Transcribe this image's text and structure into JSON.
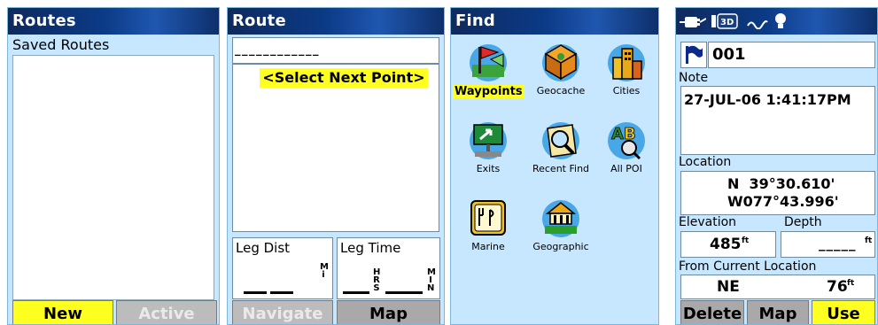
{
  "routes": {
    "title": "Routes",
    "saved_label": "Saved Routes",
    "new_button": "New",
    "active_button": "Active"
  },
  "route": {
    "title": "Route",
    "name_value": "____________",
    "select_next": "<Select Next Point>",
    "leg_dist_label": "Leg Dist",
    "leg_dist_unit": "Mi",
    "leg_time_label": "Leg Time",
    "leg_time_hrs": "HRS",
    "leg_time_min": "MIN",
    "navigate_button": "Navigate",
    "map_button": "Map"
  },
  "find": {
    "title": "Find",
    "items": [
      {
        "label": "Waypoints",
        "icon": "waypoints-icon",
        "selected": true
      },
      {
        "label": "Geocache",
        "icon": "geocache-icon"
      },
      {
        "label": "Cities",
        "icon": "cities-icon"
      },
      {
        "label": "Exits",
        "icon": "exits-icon"
      },
      {
        "label": "Recent Find",
        "icon": "recent-find-icon"
      },
      {
        "label": "All POI",
        "icon": "all-poi-icon"
      },
      {
        "label": "Marine",
        "icon": "marine-icon"
      },
      {
        "label": "Geographic",
        "icon": "geographic-icon"
      }
    ]
  },
  "waypoint": {
    "name": "001",
    "note_label": "Note",
    "note_value": "27-JUL-06 1:41:17PM",
    "location_label": "Location",
    "lat": "N  39°30.610'",
    "lon": "W077°43.996'",
    "elevation_label": "Elevation",
    "elevation_value": "485",
    "elevation_unit": "ft",
    "depth_label": "Depth",
    "depth_value": "_____",
    "depth_unit": "ft",
    "from_label": "From Current Location",
    "bearing": "NE",
    "distance": "76",
    "distance_unit": "ft",
    "delete_button": "Delete",
    "map_button": "Map",
    "use_button": "Use",
    "status_icons": [
      "power-icon",
      "3d-gps-icon",
      "satellite-signal-icon",
      "backlight-icon"
    ]
  },
  "colors": {
    "screen_bg": "#c6e7ff",
    "titlebar": "#0b3a86",
    "highlight": "#ffff20"
  }
}
